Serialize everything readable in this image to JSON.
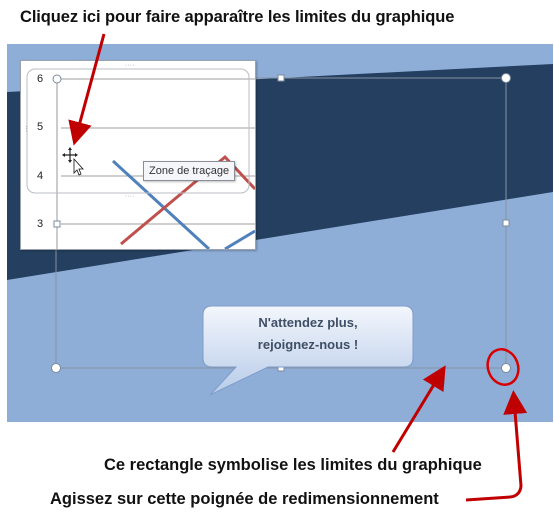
{
  "captions": {
    "top": "Cliquez ici pour faire apparaître les limites du graphique",
    "rectangle": "Ce rectangle symbolise les limites du graphique",
    "handle": "Agissez sur cette poignée de redimensionnement"
  },
  "chart": {
    "ticks": [
      "6",
      "5",
      "4",
      "3"
    ],
    "tooltip": "Zone de traçage",
    "series_colors": [
      "#4f81bd",
      "#c0504d"
    ]
  },
  "callout": {
    "line1": "N'attendez plus,",
    "line2": "rejoignez-nous !"
  },
  "colors": {
    "slide_bg": "#8eaed8",
    "band": "#243f60",
    "annotation": "#c00000"
  }
}
